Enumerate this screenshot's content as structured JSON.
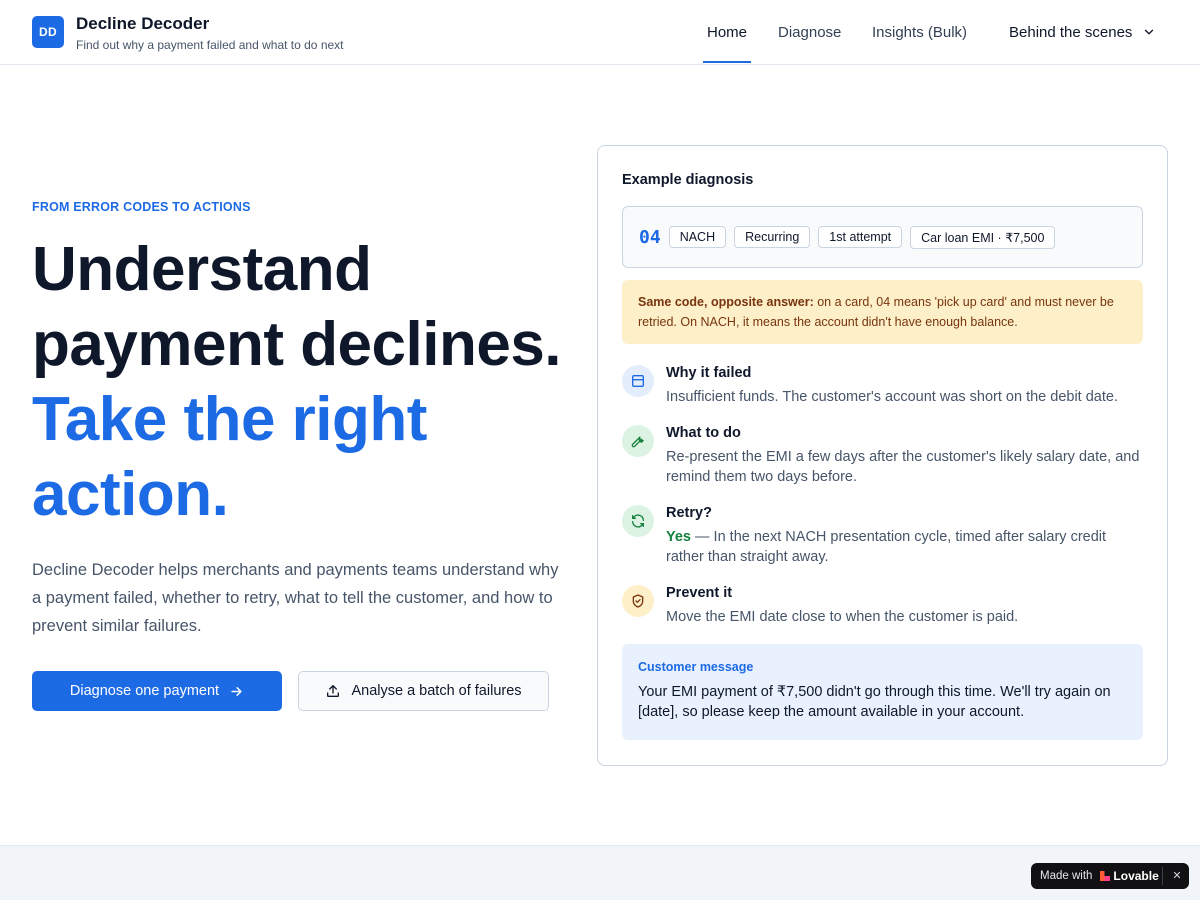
{
  "header": {
    "logo_initials": "DD",
    "brand_name": "Decline Decoder",
    "tagline": "Find out why a payment failed and what to do next",
    "nav": [
      {
        "label": "Home",
        "active": true
      },
      {
        "label": "Diagnose",
        "active": false
      },
      {
        "label": "Insights (Bulk)",
        "active": false
      }
    ],
    "behind_label": "Behind the scenes"
  },
  "hero": {
    "eyebrow": "FROM ERROR CODES TO ACTIONS",
    "title_main": "Understand payment declines.",
    "title_accent": "Take the right action.",
    "description": "Decline Decoder helps merchants and payments teams understand why a payment failed, whether to retry, what to tell the customer, and how to prevent similar failures.",
    "primary_button": "Diagnose one payment",
    "secondary_button": "Analyse a batch of failures"
  },
  "example": {
    "title": "Example diagnosis",
    "code": "04",
    "chips": [
      "NACH",
      "Recurring",
      "1st attempt",
      "Car loan EMI · ₹7,500"
    ],
    "warning_bold": "Same code, opposite answer:",
    "warning_text": "on a card, 04 means 'pick up card' and must never be retried. On NACH, it means the account didn't have enough balance.",
    "sections": [
      {
        "title": "Why it failed",
        "body": "Insufficient funds. The customer's account was short on the debit date.",
        "icon": "card-icon"
      },
      {
        "title": "What to do",
        "body": "Re-present the EMI a few days after the customer's likely salary date, and remind them two days before.",
        "icon": "wrench-icon"
      },
      {
        "title": "Retry?",
        "yes": "Yes",
        "body": "— In the next NACH presentation cycle, timed after salary credit rather than straight away.",
        "icon": "refresh-icon"
      },
      {
        "title": "Prevent it",
        "body": "Move the EMI date close to when the customer is paid.",
        "icon": "shield-icon"
      }
    ],
    "customer_message_label": "Customer message",
    "customer_message": "Your EMI payment of ₹7,500 didn't go through this time. We'll try again on [date], so please keep the amount available in your account."
  },
  "badge": {
    "made_with": "Made with",
    "brand": "Lovable",
    "close": "✕"
  },
  "colors": {
    "accent": "#1d6ae5",
    "warning_bg": "#fdefc8",
    "message_bg": "#e8f1fd"
  }
}
